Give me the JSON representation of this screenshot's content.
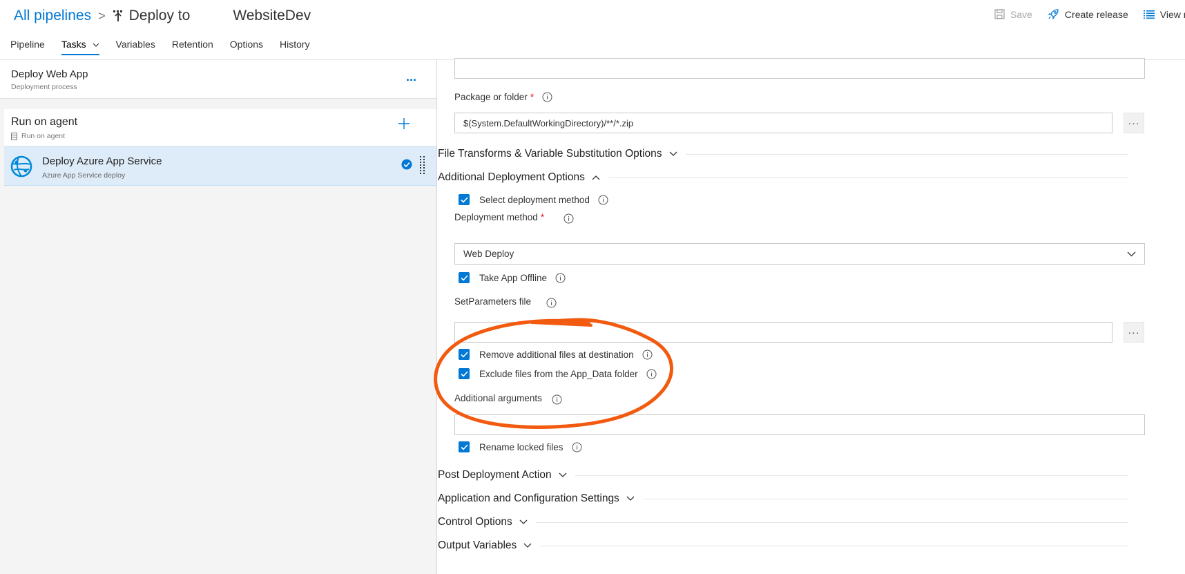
{
  "breadcrumb": {
    "root": "All pipelines",
    "separator": ">",
    "title": "Deploy to",
    "title_suffix": "WebsiteDev"
  },
  "toolbar": {
    "save_label": "Save",
    "create_release_label": "Create release",
    "view_releases_label": "View rele"
  },
  "tabs": [
    {
      "label": "Pipeline"
    },
    {
      "label": "Tasks"
    },
    {
      "label": "Variables"
    },
    {
      "label": "Retention"
    },
    {
      "label": "Options"
    },
    {
      "label": "History"
    }
  ],
  "process": {
    "title": "Deploy Web App",
    "subtitle": "Deployment process",
    "more": "..."
  },
  "agent": {
    "title": "Run on agent",
    "subtitle": "Run on agent"
  },
  "task": {
    "title": "Deploy Azure App Service",
    "subtitle": "Azure App Service deploy"
  },
  "form": {
    "top_input_value": "",
    "package_label": "Package or folder",
    "package_value": "$(System.DefaultWorkingDirectory)/**/*.zip",
    "ellipsis": "···",
    "required_mark": "*",
    "sections": {
      "file_transforms": "File Transforms & Variable Substitution Options",
      "additional_deploy": "Additional Deployment Options",
      "post_deploy": "Post Deployment Action",
      "app_config": "Application and Configuration Settings",
      "control": "Control Options",
      "output_vars": "Output Variables"
    },
    "select_method_label": "Select deployment method",
    "deploy_method_label": "Deployment method",
    "deploy_method_value": "Web Deploy",
    "take_offline_label": "Take App Offline",
    "setparams_label": "SetParameters file",
    "setparams_value": "",
    "remove_files_label": "Remove additional files at destination",
    "exclude_appdata_label": "Exclude files from the App_Data folder",
    "additional_args_label": "Additional arguments",
    "additional_args_value": "",
    "rename_locked_label": "Rename locked files"
  },
  "colors": {
    "accent": "#0078d4",
    "selected_row": "#deecf9",
    "annotation": "#f25a0f",
    "required": "#e81123"
  }
}
